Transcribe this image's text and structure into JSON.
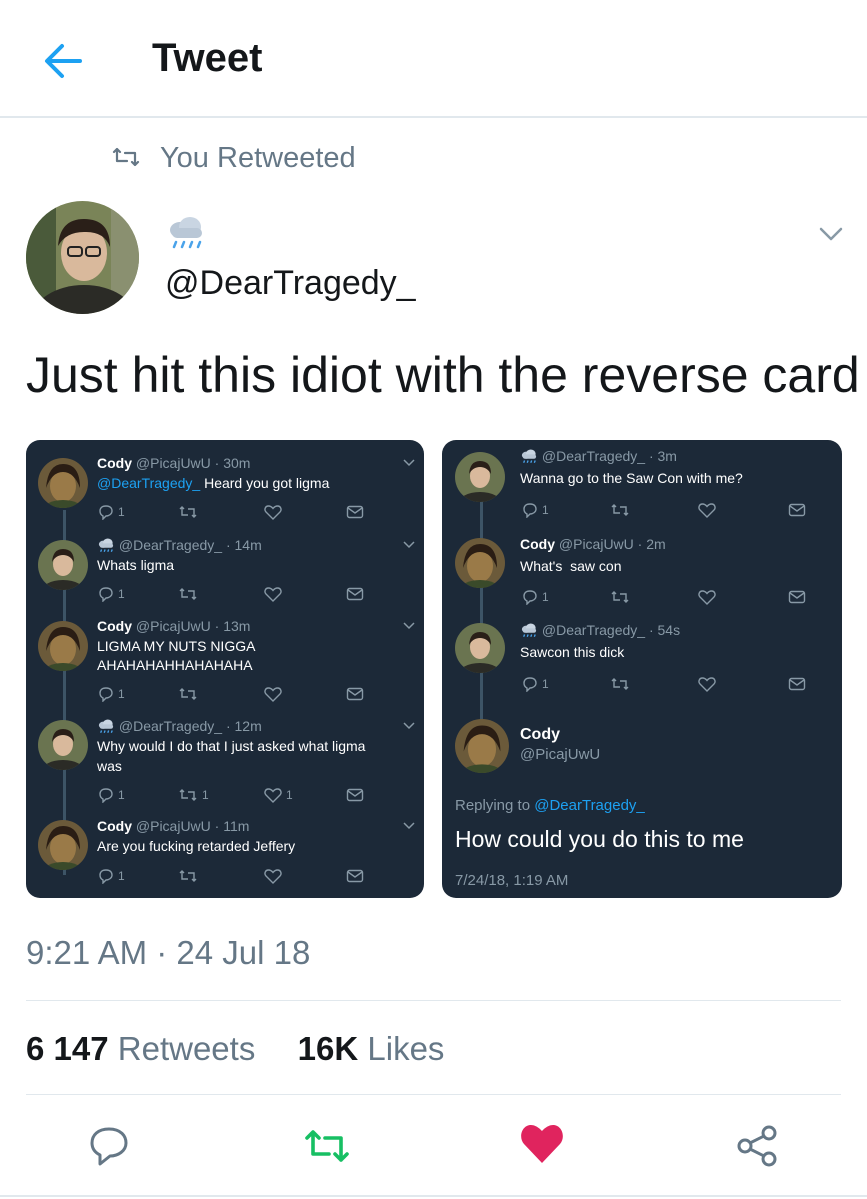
{
  "header": {
    "title": "Tweet",
    "back_icon": "arrow-left-icon"
  },
  "retweet_banner": {
    "label": "You Retweeted",
    "icon": "retweet-icon"
  },
  "author": {
    "display_emoji": "rain-cloud-emoji",
    "handle": "@DearTragedy_"
  },
  "tweet": {
    "text": "Just hit this idiot with the reverse card"
  },
  "screenshot_left": {
    "messages": [
      {
        "name": "Cody",
        "meta": "@PicajUwU · 30m",
        "mention": "@DearTragedy_",
        "text": " Heard you got ligma",
        "reply_count": "1",
        "retweet_count": "",
        "like_count": ""
      },
      {
        "name": "",
        "meta": "@DearTragedy_ · 14m",
        "text": "Whats ligma",
        "reply_count": "1",
        "retweet_count": "",
        "like_count": ""
      },
      {
        "name": "Cody",
        "meta": "@PicajUwU · 13m",
        "text": "LIGMA MY NUTS NIGGA",
        "text2": "AHAHAHAHHAHAHAHA",
        "reply_count": "1",
        "retweet_count": "",
        "like_count": ""
      },
      {
        "name": "",
        "meta": "@DearTragedy_ · 12m",
        "text": "Why would I do that I just asked what ligma",
        "text2": "was",
        "reply_count": "1",
        "retweet_count": "1",
        "like_count": "1"
      },
      {
        "name": "Cody",
        "meta": "@PicajUwU · 11m",
        "text": "Are you fucking retarded Jeffery",
        "reply_count": "1",
        "retweet_count": "",
        "like_count": ""
      }
    ]
  },
  "screenshot_right": {
    "messages": [
      {
        "name": "",
        "meta": "@DearTragedy_ · 3m",
        "text": "Wanna go to the Saw Con with me?",
        "reply_count": "1"
      },
      {
        "name": "Cody",
        "meta": "@PicajUwU · 2m",
        "text": "What's  saw con",
        "reply_count": "1"
      },
      {
        "name": "",
        "meta": "@DearTragedy_ · 54s",
        "text": "Sawcon this dick",
        "reply_count": "1"
      }
    ],
    "focused": {
      "name": "Cody",
      "handle": "@PicajUwU",
      "replying_prefix": "Replying to ",
      "replying_to": "@DearTragedy_",
      "text": "How could you do this to me",
      "time": "7/24/18, 1:19 AM"
    }
  },
  "timestamp": "9:21 AM · 24 Jul 18",
  "stats": {
    "retweets_count": "6 147",
    "retweets_label": "Retweets",
    "likes_count": "16K",
    "likes_label": "Likes"
  },
  "actions": {
    "reply": "reply-icon",
    "retweet": "retweet-icon",
    "like": "heart-icon",
    "share": "share-icon"
  },
  "colors": {
    "accent": "#1da1f2",
    "retweet": "#17bf63",
    "like": "#e0245e",
    "dark_bg": "#1c2938",
    "gray": "#657786"
  }
}
